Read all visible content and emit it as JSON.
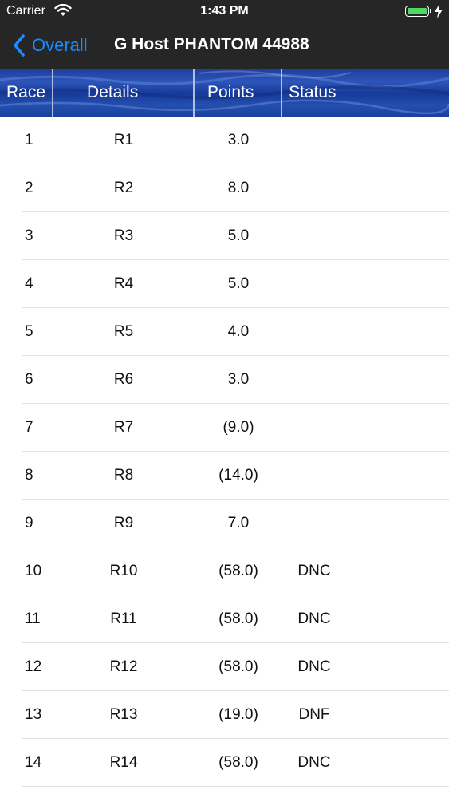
{
  "status_bar": {
    "carrier": "Carrier",
    "time": "1:43 PM",
    "battery_level": 1.0,
    "battery_color": "#4cd964"
  },
  "nav": {
    "back_label": "Overall",
    "title": "G Host PHANTOM 44988",
    "accent_color": "#1a8cff"
  },
  "table": {
    "columns": {
      "race": "Race",
      "details": "Details",
      "points": "Points",
      "status": "Status"
    },
    "rows": [
      {
        "race": "1",
        "details": "R1",
        "points": "3.0",
        "status": ""
      },
      {
        "race": "2",
        "details": "R2",
        "points": "8.0",
        "status": ""
      },
      {
        "race": "3",
        "details": "R3",
        "points": "5.0",
        "status": ""
      },
      {
        "race": "4",
        "details": "R4",
        "points": "5.0",
        "status": ""
      },
      {
        "race": "5",
        "details": "R5",
        "points": "4.0",
        "status": ""
      },
      {
        "race": "6",
        "details": "R6",
        "points": "3.0",
        "status": ""
      },
      {
        "race": "7",
        "details": "R7",
        "points": "(9.0)",
        "status": ""
      },
      {
        "race": "8",
        "details": "R8",
        "points": "(14.0)",
        "status": ""
      },
      {
        "race": "9",
        "details": "R9",
        "points": "7.0",
        "status": ""
      },
      {
        "race": "10",
        "details": "R10",
        "points": "(58.0)",
        "status": "DNC"
      },
      {
        "race": "11",
        "details": "R11",
        "points": "(58.0)",
        "status": "DNC"
      },
      {
        "race": "12",
        "details": "R12",
        "points": "(58.0)",
        "status": "DNC"
      },
      {
        "race": "13",
        "details": "R13",
        "points": "(19.0)",
        "status": "DNF"
      },
      {
        "race": "14",
        "details": "R14",
        "points": "(58.0)",
        "status": "DNC"
      }
    ]
  }
}
